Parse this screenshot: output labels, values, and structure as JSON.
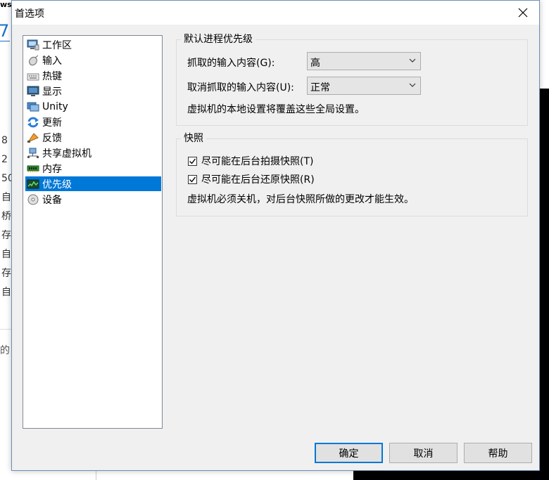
{
  "background": {
    "top_text": "ws",
    "big_digit": "7",
    "side_fragments": [
      "8 (",
      "2",
      "50",
      "自",
      "桥",
      "存",
      "自",
      "存",
      "自"
    ],
    "bottom_fragment": "的"
  },
  "dialog": {
    "title": "首选项",
    "close_glyph": "✕"
  },
  "tree": {
    "items": [
      {
        "label": "工作区",
        "icon": "workspace-icon"
      },
      {
        "label": "输入",
        "icon": "mouse-icon"
      },
      {
        "label": "热键",
        "icon": "keyboard-icon"
      },
      {
        "label": "显示",
        "icon": "monitor-icon"
      },
      {
        "label": "Unity",
        "icon": "unity-icon"
      },
      {
        "label": "更新",
        "icon": "update-icon"
      },
      {
        "label": "反馈",
        "icon": "feedback-icon"
      },
      {
        "label": "共享虚拟机",
        "icon": "shared-vm-icon"
      },
      {
        "label": "内存",
        "icon": "memory-icon"
      },
      {
        "label": "优先级",
        "icon": "priority-icon",
        "selected": true
      },
      {
        "label": "设备",
        "icon": "device-icon"
      }
    ],
    "accent_color": "#0078d7"
  },
  "priority_group": {
    "legend": "默认进程优先级",
    "grabbed_label": "抓取的输入内容(G):",
    "grabbed_value": "高",
    "ungrabbed_label": "取消抓取的输入内容(U):",
    "ungrabbed_value": "正常",
    "note": "虚拟机的本地设置将覆盖这些全局设置。"
  },
  "snapshot_group": {
    "legend": "快照",
    "take_background_label": "尽可能在后台拍摄快照(T)",
    "take_background_checked": true,
    "restore_background_label": "尽可能在后台还原快照(R)",
    "restore_background_checked": true,
    "note": "虚拟机必须关机，对后台快照所做的更改才能生效。"
  },
  "buttons": {
    "ok": "确定",
    "cancel": "取消",
    "help": "帮助"
  }
}
